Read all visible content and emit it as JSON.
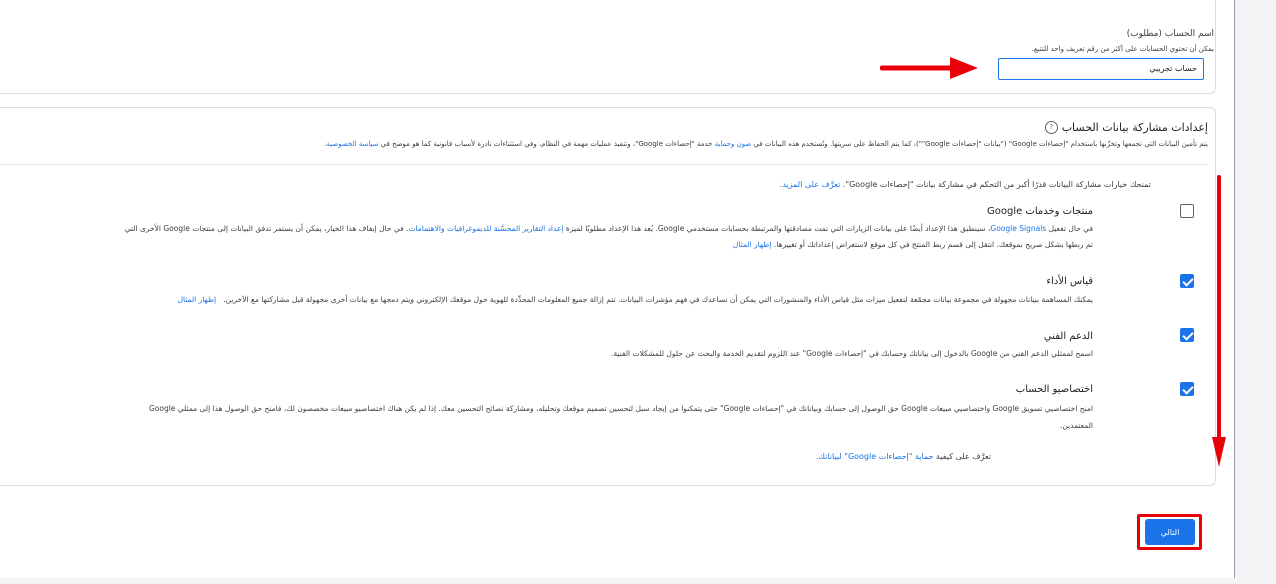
{
  "account_name": {
    "label": "اسم الحساب (مطلوب)",
    "help": "يمكن أن تحتوي الحسابات على أكثر من رقم تعريف واحد للتتبع.",
    "value": "حساب تجريبي"
  },
  "sharing": {
    "title": "إعدادات مشاركة بيانات الحساب",
    "help_icon": "?",
    "desc_start": "يتم تأمين البيانات التي تجمعها وتخزّنها باستخدام \"إحصاءات Google\" (\"بيانات \"إحصاءات Google\"\")، كما يتم الحفاظ على سريتها. وتُستخدم هذه البيانات في ",
    "desc_link1": "صون وحماية",
    "desc_middle": " خدمة \"إحصاءات Google\"، وتنفيذ عمليات مهمة في النظام، وفي استثناءات نادرة لأسباب قانونية كما هو موضح في ",
    "desc_link2": "سياسة الخصوصية",
    "desc_end": ".",
    "intro": "تمنحك خيارات مشاركة البيانات قدرًا أكبر من التحكم في مشاركة بيانات \"إحصاءات Google\". ",
    "intro_link": "تعرَّف على المزيد."
  },
  "options": [
    {
      "title": "منتجات وخدمات Google",
      "checked": false,
      "line1_a": "في حال تفعيل ",
      "line1_link1": "Google Signals",
      "line1_b": "، سينطبق هذا الإعداد أيضًا على بيانات الزيارات التي تمت مصادقتها والمرتبطة بحسابات مستخدمي Google. يُعد هذا الإعداد مطلوبًا لميزة ",
      "line1_link2": "إعداد التقارير المحسَّنة للديموغرافيات والاهتمامات",
      "line1_c": ". في حال إيقاف هذا الخيار، يمكن أن يستمر تدفق البيانات إلى منتجات Google الأخرى التي",
      "line2": "تم ربطها بشكل صريح بموقعك. انتقل إلى قسم ربط المنتج في كل موقع لاستعراض إعداداتك أو تغييرها. ",
      "line2_link": "إظهار المثال"
    },
    {
      "title": "قياس الأداء",
      "checked": true,
      "line1_a": "يمكنك المساهمة ببيانات مجهولة في مجموعة بيانات مجمّعة لتفعيل ميزات مثل قياس الأداء والمنشورات التي يمكن أن تساعدك في فهم مؤشرات البيانات. تتم إزالة جميع المعلومات المحدِّدة للهوية حول موقعك الإلكتروني ويتم دمجها مع بيانات أخرى مجهولة قبل مشاركتها مع الآخرين.",
      "line1_link1": "إظهار المثال"
    },
    {
      "title": "الدعم الفني",
      "checked": true,
      "line1_a": "اسمح لممثلي الدعم الفني من Google بالدخول إلى بياناتك وحسابك في \"إحصاءات Google\" عند اللزوم لتقديم الخدمة والبحث عن حلول للمشكلات الفنية."
    },
    {
      "title": "اختصاصيو الحساب",
      "checked": true,
      "line1_a": "امنح اختصاصيي تسويق Google واختصاصيي مبيعات Google حق الوصول إلى حسابك وبياناتك في \"إحصاءات Google\" حتى يتمكنوا من إيجاد سبل لتحسين تصميم موقعك وتحليله، ومشاركة نصائح التحسين معك. إذا لم يكن هناك اختصاصيو مبيعات مخصصون لك، فامنح حق الوصول هذا إلى ممثلي Google",
      "line2": "المعتمدين."
    }
  ],
  "footer": {
    "prefix": "تعرَّف على كيفية ",
    "link": "حماية \"إحصاءات Google\" لبياناتك",
    "suffix": "."
  },
  "next_button": "التالي",
  "colors": {
    "accent": "#1a73e8",
    "annotation_red": "#e8000b"
  }
}
